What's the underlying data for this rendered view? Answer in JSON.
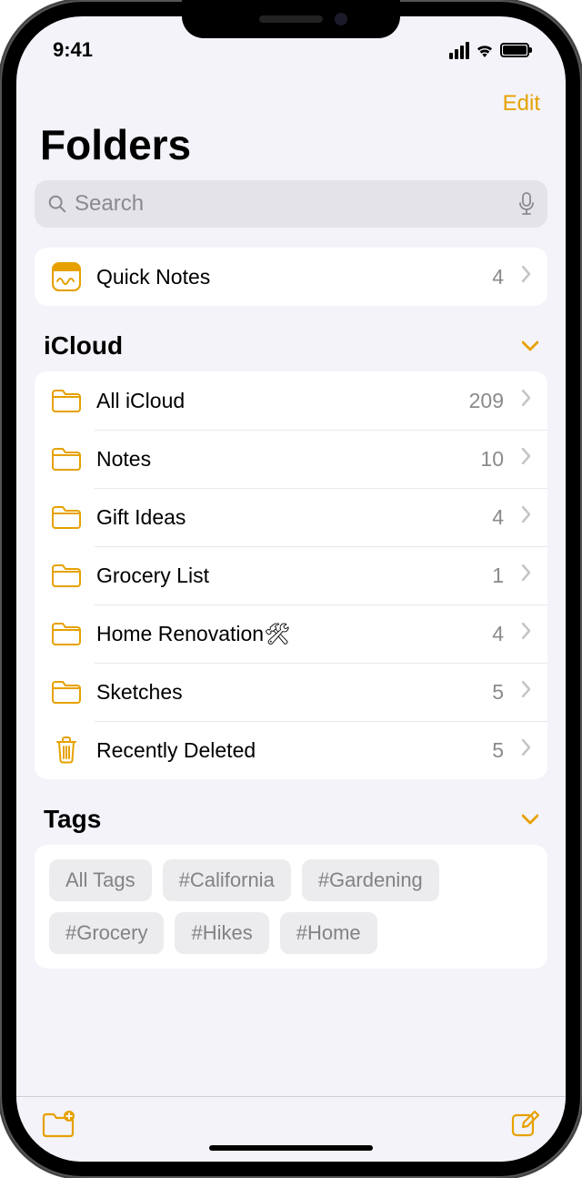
{
  "status": {
    "time": "9:41"
  },
  "nav": {
    "edit": "Edit"
  },
  "title": "Folders",
  "search": {
    "placeholder": "Search"
  },
  "quickNotes": {
    "label": "Quick Notes",
    "count": "4"
  },
  "sections": {
    "icloud": {
      "title": "iCloud",
      "folders": [
        {
          "label": "All iCloud",
          "count": "209"
        },
        {
          "label": "Notes",
          "count": "10"
        },
        {
          "label": "Gift Ideas",
          "count": "4"
        },
        {
          "label": "Grocery List",
          "count": "1"
        },
        {
          "label": "Home Renovation🛠",
          "count": "4"
        },
        {
          "label": "Sketches",
          "count": "5"
        },
        {
          "label": "Recently Deleted",
          "count": "5"
        }
      ]
    },
    "tags": {
      "title": "Tags",
      "items": [
        "All Tags",
        "#California",
        "#Gardening",
        "#Grocery",
        "#Hikes",
        "#Home"
      ]
    }
  }
}
